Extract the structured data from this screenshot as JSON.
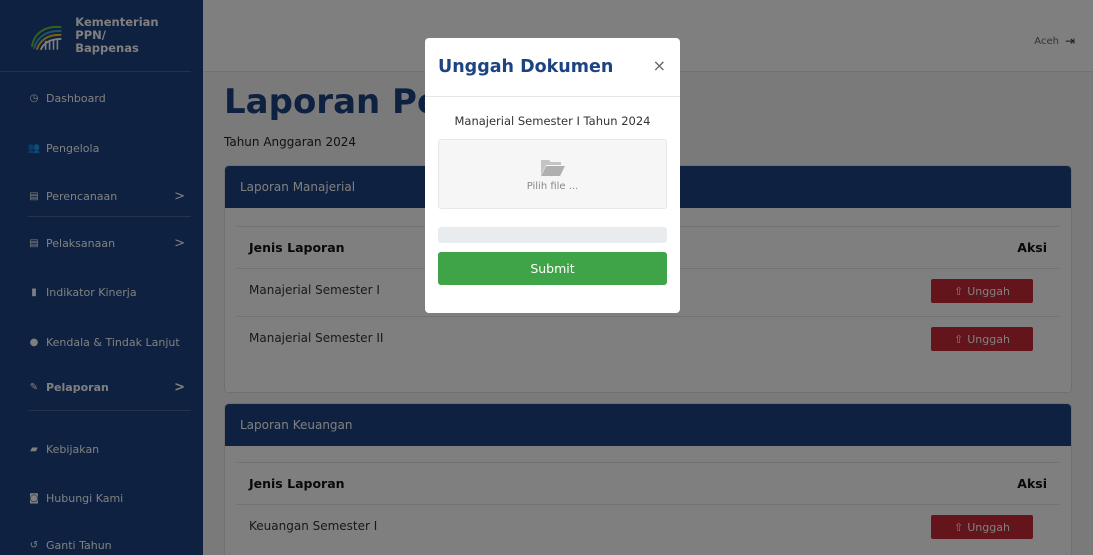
{
  "brand": {
    "line1": "Kementerian PPN/",
    "line2": "Bappenas"
  },
  "sidebar": {
    "items": [
      {
        "label": "Dashboard",
        "icon": "dashboard-icon"
      },
      {
        "label": "Pengelola",
        "icon": "users-icon"
      },
      {
        "label": "Perencanaan",
        "icon": "clipboard-icon",
        "chevron": ">"
      },
      {
        "label": "Pelaksanaan",
        "icon": "clipboard-icon",
        "chevron": ">"
      },
      {
        "label": "Indikator Kinerja",
        "icon": "bar-chart-icon"
      },
      {
        "label": "Kendala & Tindak Lanjut",
        "icon": "info-icon"
      },
      {
        "label": "Pelaporan",
        "icon": "file-edit-icon",
        "chevron": ">",
        "active": true
      },
      {
        "label": "Kebijakan",
        "icon": "folder-icon"
      },
      {
        "label": "Hubungi Kami",
        "icon": "chat-icon"
      },
      {
        "label": "Ganti Tahun",
        "icon": "history-icon"
      }
    ]
  },
  "topbar": {
    "user": "Aceh",
    "logout_icon": "logout-icon"
  },
  "page": {
    "title": "Laporan Pelaporan",
    "subtitle": "Tahun Anggaran 2024"
  },
  "cards": [
    {
      "title": "Laporan Manajerial",
      "col_jenis": "Jenis Laporan",
      "col_aksi": "Aksi",
      "rows": [
        "Manajerial Semester I",
        "Manajerial Semester II"
      ]
    },
    {
      "title": "Laporan Keuangan",
      "col_jenis": "Jenis Laporan",
      "col_aksi": "Aksi",
      "rows": [
        "Keuangan Semester I"
      ]
    }
  ],
  "button_unggah": "Unggah",
  "modal": {
    "title": "Unggah Dokumen",
    "close": "×",
    "subtitle": "Manajerial Semester I Tahun 2024",
    "dropzone_text": "Pilih file ...",
    "submit": "Submit",
    "progress": 0
  },
  "colors": {
    "primary": "#1d4380",
    "danger": "#c92a39",
    "success": "#3fa348"
  }
}
